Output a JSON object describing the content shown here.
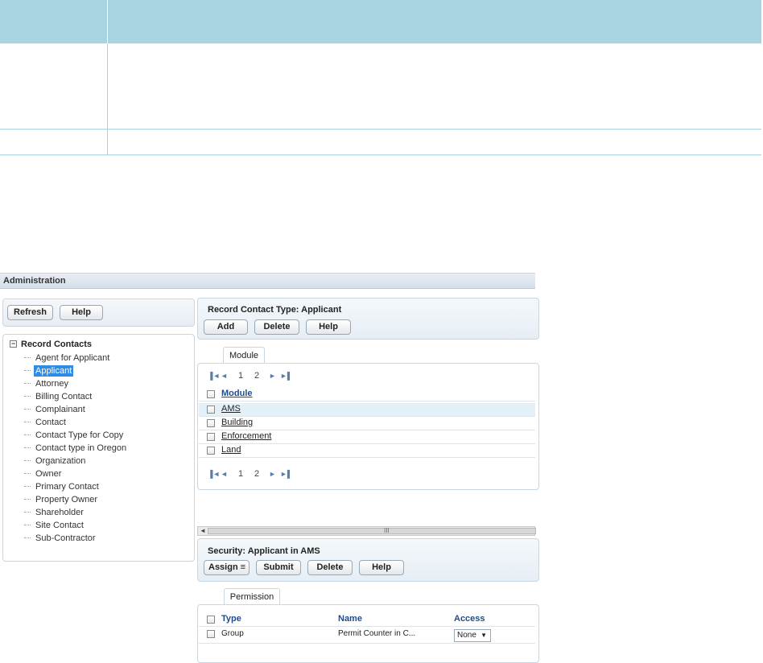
{
  "app": {
    "title": "Administration"
  },
  "toolbar": {
    "refresh_label": "Refresh",
    "help_label": "Help"
  },
  "tree": {
    "root_label": "Record Contacts",
    "toggle": "−",
    "items": [
      "Agent for Applicant",
      "Applicant",
      "Attorney",
      "Billing Contact",
      "Complainant",
      "Contact",
      "Contact Type for Copy",
      "Contact type in Oregon",
      "Organization",
      "Owner",
      "Primary Contact",
      "Property Owner",
      "Shareholder",
      "Site Contact",
      "Sub-Contractor"
    ],
    "selected": "Applicant"
  },
  "contact_type": {
    "title": "Record Contact Type: Applicant",
    "add_label": "Add",
    "delete_label": "Delete",
    "help_label": "Help",
    "tab": "Module",
    "pager": {
      "pages": [
        "1",
        "2"
      ]
    },
    "column": "Module",
    "rows": [
      "AMS",
      "Building",
      "Enforcement",
      "Land"
    ]
  },
  "scrollbar": {
    "left_arrow": "◄",
    "grip": "III"
  },
  "security": {
    "title": "Security: Applicant in AMS",
    "assign_label": "Assign",
    "submit_label": "Submit",
    "delete_label": "Delete",
    "help_label": "Help",
    "tab": "Permission",
    "columns": [
      "Type",
      "Name",
      "Access"
    ],
    "rows": [
      {
        "type": "Group",
        "name": "Permit Counter in C...",
        "access": "None"
      }
    ]
  },
  "icons": {
    "first": "▐◄",
    "prev": "◄",
    "next": "►",
    "last": "►▌",
    "dropdown": "▼",
    "menu": "≡"
  }
}
